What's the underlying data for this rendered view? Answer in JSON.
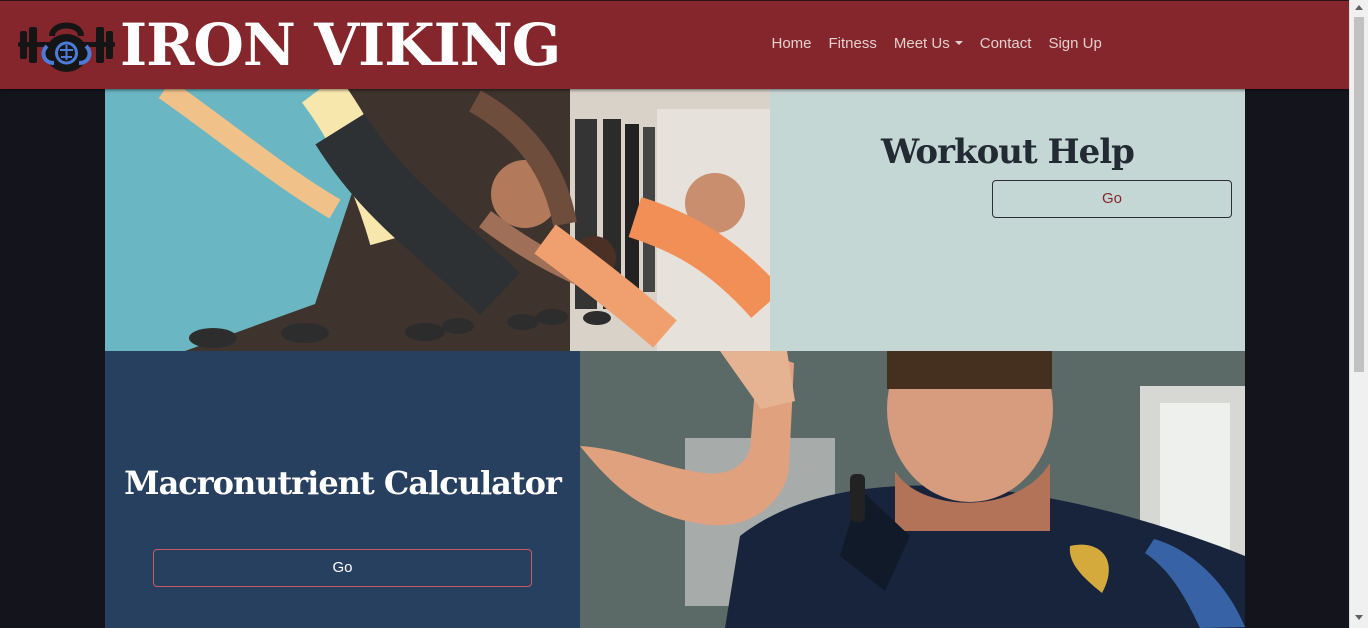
{
  "brand": {
    "logo": "kettlebell-barbell-logo",
    "name": "IRON VIKING"
  },
  "nav": {
    "items": [
      {
        "label": "Home"
      },
      {
        "label": "Fitness"
      },
      {
        "label": "Meet Us",
        "dropdown": true
      },
      {
        "label": "Contact"
      },
      {
        "label": "Sign Up"
      }
    ]
  },
  "tiles": {
    "workout": {
      "title": "Workout Help",
      "button": "Go"
    },
    "macro": {
      "title": "Macronutrient Calculator",
      "button": "Go"
    },
    "images": {
      "gym": "group-kettlebell-pushup-photo",
      "officer": "police-officer-flexing-photo"
    }
  },
  "colors": {
    "navbar": "#84262b",
    "workout_panel": "#c5d7d5",
    "macro_panel": "#28405f",
    "background": "#14141c",
    "accent_text": "#84262b"
  }
}
